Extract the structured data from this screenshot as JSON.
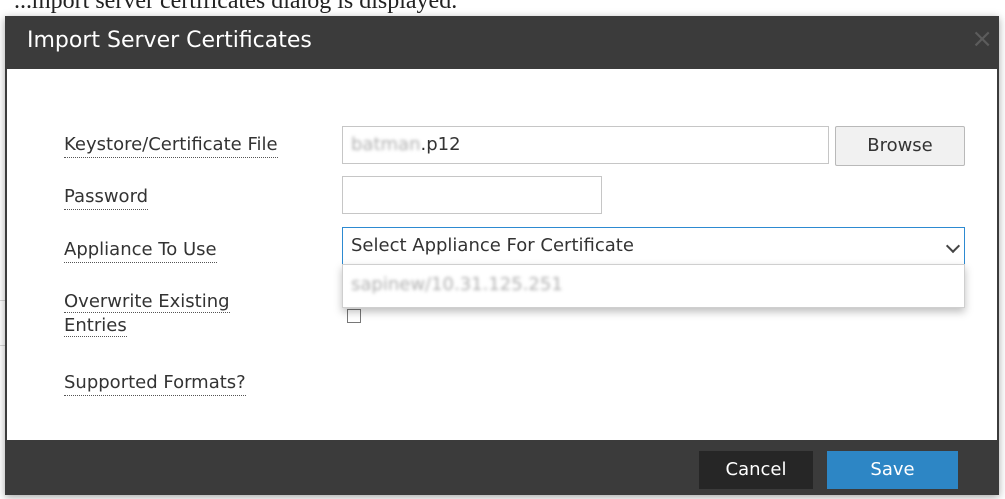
{
  "background": {
    "caption_fragment": "...mport server certificates dialog is displayed."
  },
  "dialog": {
    "title": "Import Server Certificates",
    "close_glyph": "×"
  },
  "form": {
    "keystore_label": "Keystore/Certificate File",
    "keystore_value_blurred": "batman",
    "keystore_value_suffix": ".p12",
    "browse_label": "Browse",
    "password_label": "Password",
    "password_value": "",
    "appliance_label": "Appliance To Use",
    "appliance_selected": "Select Appliance For Certificate",
    "appliance_options": [
      "sapinew/10.31.125.251"
    ],
    "overwrite_label_line1": "Overwrite Existing",
    "overwrite_label_line2": "Entries",
    "overwrite_checked": false,
    "supported_formats_label": "Supported Formats?"
  },
  "footer": {
    "cancel_label": "Cancel",
    "save_label": "Save"
  },
  "colors": {
    "dialog_chrome": "#3b3b3b",
    "primary_button": "#2d86c5",
    "secondary_button": "#262626",
    "focus_border": "#2d8ad1"
  },
  "icons": {
    "close": "close-icon",
    "select_arrow": "chevron-down-icon"
  }
}
